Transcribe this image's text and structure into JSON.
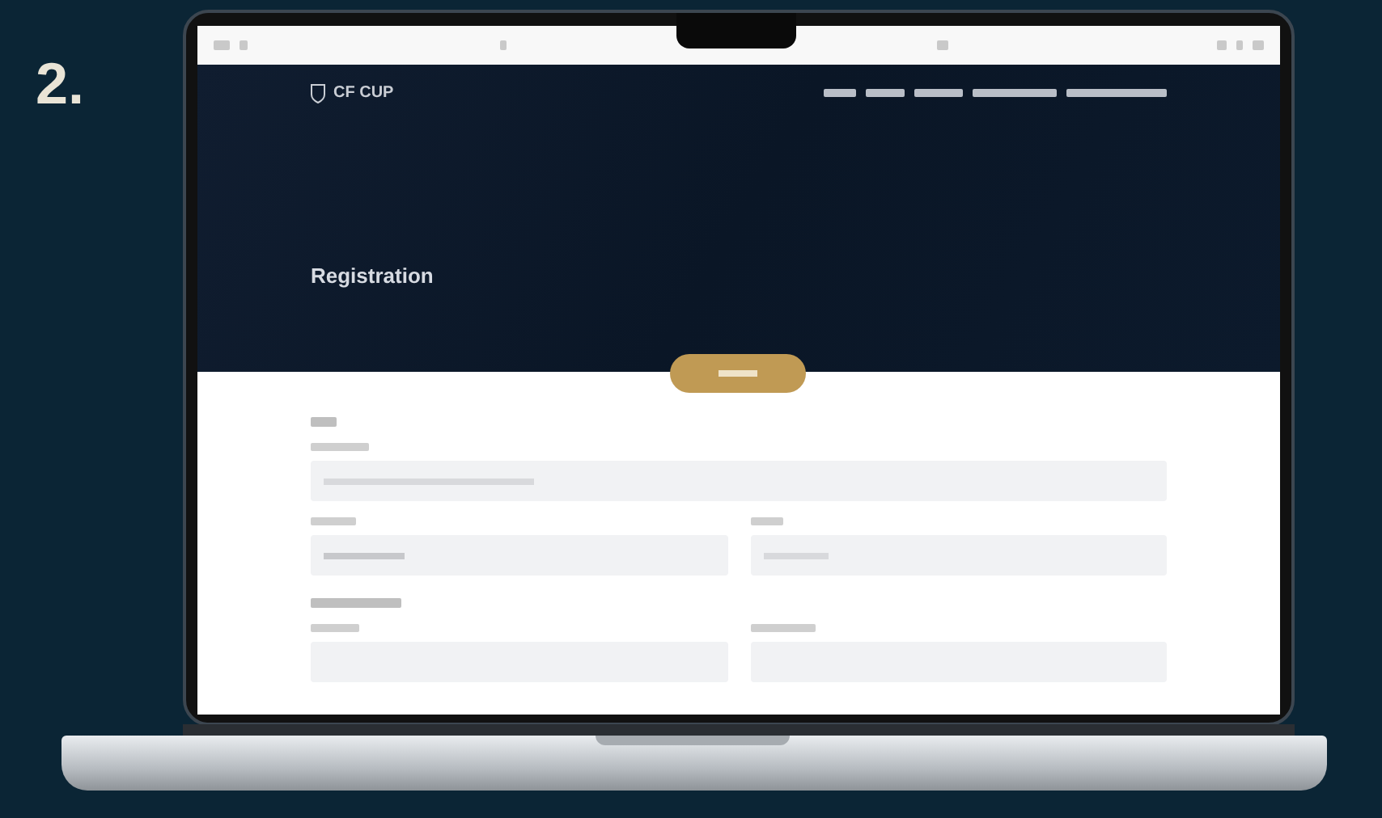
{
  "step_label": "2.",
  "site": {
    "logo": "CF CUP",
    "hero_title": "Registration"
  }
}
